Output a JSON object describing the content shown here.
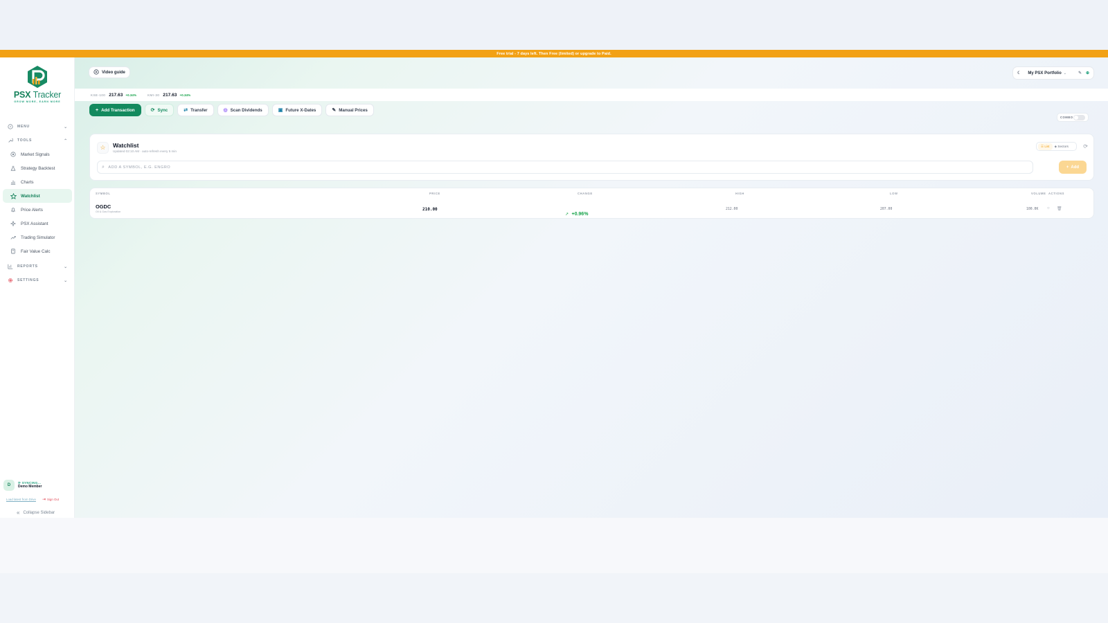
{
  "banner": {
    "text": "Free trial - 7 days left. Then Free (limited) or upgrade to Paid."
  },
  "brand": {
    "name_psx": "PSX",
    "name_tracker": "Tracker",
    "tagline": "GROW MORE, EARN MORE",
    "colors": {
      "primary": "#138a5e",
      "accent": "#f2a115"
    }
  },
  "sidebar": {
    "menu_label": "MENU",
    "tools_label": "TOOLS",
    "items": [
      {
        "label": "Market Signals",
        "icon": "signal-icon"
      },
      {
        "label": "Strategy Backtest",
        "icon": "flask-icon"
      },
      {
        "label": "Charts",
        "icon": "bar-chart-icon"
      },
      {
        "label": "Watchlist",
        "icon": "star-icon"
      },
      {
        "label": "Price Alerts",
        "icon": "bell-icon"
      },
      {
        "label": "PSX Assistant",
        "icon": "sparkle-icon"
      },
      {
        "label": "Trading Simulator",
        "icon": "trend-icon"
      },
      {
        "label": "Fair Value Calc",
        "icon": "calculator-icon"
      }
    ],
    "reports_label": "REPORTS",
    "settings_label": "SETTINGS",
    "user": {
      "initial": "D",
      "status": "SYNCING...",
      "name": "Demo Member"
    },
    "drive_link": "Load latest from Drive",
    "sign_out": "Sign Out",
    "collapse": "Collapse Sidebar"
  },
  "topbar": {
    "video_guide": "Video guide",
    "portfolio": "My PSX Portfolio"
  },
  "tickers": [
    {
      "symbol": "KSE-100",
      "value": "217.63",
      "change": "+0.34%"
    },
    {
      "symbol": "KMI-30",
      "value": "217.63",
      "change": "+0.34%"
    }
  ],
  "actions": {
    "add_transaction": "Add Transaction",
    "sync": "Sync",
    "transfer": "Transfer",
    "scan_dividends": "Scan Dividends",
    "future_xdates": "Future X-Dates",
    "manual_prices": "Manual Prices",
    "combo": "COMBO"
  },
  "watchlist": {
    "title": "Watchlist",
    "subtitle": "Updated 02:10 AM · auto-refresh every 5 min",
    "view_list": "List",
    "view_sectors": "Sectors",
    "search_placeholder": "ADD A SYMBOL, E.G. ENGRO",
    "add_button": "Add"
  },
  "table": {
    "headers": {
      "symbol": "SYMBOL",
      "price": "PRICE",
      "change": "CHANGE",
      "high": "HIGH",
      "low": "LOW",
      "volume": "VOLUME",
      "actions": "ACTIONS"
    },
    "rows": [
      {
        "symbol": "OGDC",
        "sector": "Oil & Gas Exploration",
        "price": "210.00",
        "change": "+0.96%",
        "high": "212.00",
        "low": "207.00",
        "volume": "100.0K"
      }
    ]
  }
}
